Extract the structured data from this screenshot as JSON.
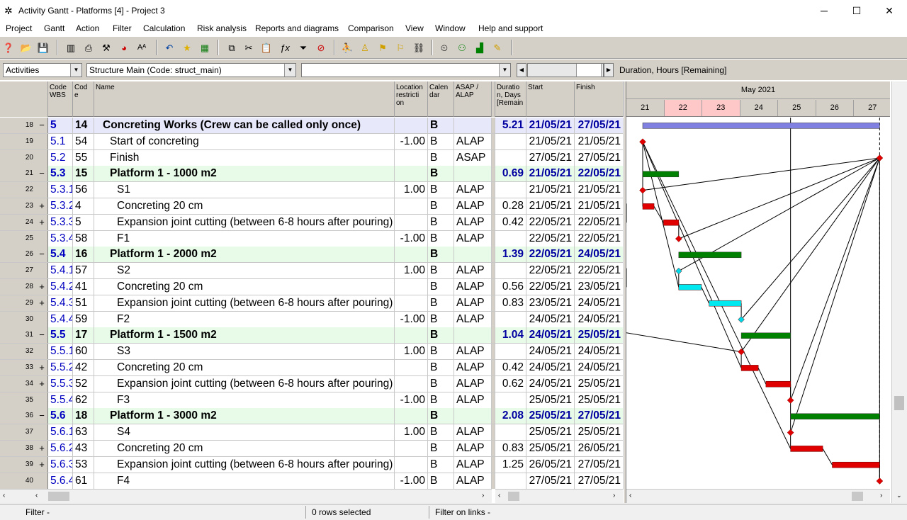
{
  "window": {
    "title": "Activity Gantt - Platforms [4] - Project 3",
    "minimize": "─",
    "maximize": "☐",
    "close": "✕"
  },
  "menu": [
    "Project",
    "Gantt",
    "Action",
    "Filter",
    "Calculation",
    "Risk analysis",
    "Reports and diagrams",
    "Comparison",
    "View",
    "Window",
    "Help and support"
  ],
  "filterbar": {
    "view_select": "Activities",
    "structure_select": "Structure Main (Code: struct_main)",
    "blank_select": "",
    "metric_label": "Duration, Hours [Remaining]"
  },
  "columns": {
    "rownum": "",
    "wbs": "Code\nWBS",
    "code": "Cod\ne",
    "name": "Name",
    "location": "Location\nrestricti\non",
    "calendar": "Calen\ndar",
    "asap": "ASAP /\nALAP",
    "duration": "Duratio\nn, Days\n[Remain",
    "start": "Start",
    "finish": "Finish"
  },
  "gantt_header": {
    "month": "May 2021",
    "days": [
      "21",
      "22",
      "23",
      "24",
      "25",
      "26",
      "27"
    ]
  },
  "rows": [
    {
      "n": "18",
      "ex": "−",
      "wbs": "5",
      "code": "14",
      "name": "Concreting Works (Crew can be called only once)",
      "loc": "",
      "cal": "B",
      "asap": "",
      "dur": "5.21",
      "start": "21/05/21",
      "finish": "27/05/21",
      "type": "top",
      "indent": 0
    },
    {
      "n": "19",
      "ex": "",
      "wbs": "5.1",
      "code": "54",
      "name": "Start of concreting",
      "loc": "-1.00",
      "cal": "B",
      "asap": "ALAP",
      "dur": "",
      "start": "21/05/21",
      "finish": "21/05/21",
      "type": "",
      "indent": 1
    },
    {
      "n": "20",
      "ex": "",
      "wbs": "5.2",
      "code": "55",
      "name": "Finish",
      "loc": "",
      "cal": "B",
      "asap": "ASAP",
      "dur": "",
      "start": "27/05/21",
      "finish": "27/05/21",
      "type": "",
      "indent": 1
    },
    {
      "n": "21",
      "ex": "−",
      "wbs": "5.3",
      "code": "15",
      "name": "Platform 1 - 1000 m2",
      "loc": "",
      "cal": "B",
      "asap": "",
      "dur": "0.69",
      "start": "21/05/21",
      "finish": "22/05/21",
      "type": "sum",
      "indent": 1
    },
    {
      "n": "22",
      "ex": "",
      "wbs": "5.3.1",
      "code": "56",
      "name": "S1",
      "loc": "1.00",
      "cal": "B",
      "asap": "ALAP",
      "dur": "",
      "start": "21/05/21",
      "finish": "21/05/21",
      "type": "",
      "indent": 2
    },
    {
      "n": "23",
      "ex": "+",
      "wbs": "5.3.2",
      "code": "4",
      "name": "Concreting 20 cm",
      "loc": "",
      "cal": "B",
      "asap": "ALAP",
      "dur": "0.28",
      "start": "21/05/21",
      "finish": "21/05/21",
      "type": "",
      "indent": 2
    },
    {
      "n": "24",
      "ex": "+",
      "wbs": "5.3.3",
      "code": "5",
      "name": "Expansion joint cutting (between 6-8 hours after pouring)",
      "loc": "",
      "cal": "B",
      "asap": "ALAP",
      "dur": "0.42",
      "start": "22/05/21",
      "finish": "22/05/21",
      "type": "",
      "indent": 2
    },
    {
      "n": "25",
      "ex": "",
      "wbs": "5.3.4",
      "code": "58",
      "name": "F1",
      "loc": "-1.00",
      "cal": "B",
      "asap": "ALAP",
      "dur": "",
      "start": "22/05/21",
      "finish": "22/05/21",
      "type": "",
      "indent": 2
    },
    {
      "n": "26",
      "ex": "−",
      "wbs": "5.4",
      "code": "16",
      "name": "Platform 1 - 2000 m2",
      "loc": "",
      "cal": "B",
      "asap": "",
      "dur": "1.39",
      "start": "22/05/21",
      "finish": "24/05/21",
      "type": "sum",
      "indent": 1
    },
    {
      "n": "27",
      "ex": "",
      "wbs": "5.4.1",
      "code": "57",
      "name": "S2",
      "loc": "1.00",
      "cal": "B",
      "asap": "ALAP",
      "dur": "",
      "start": "22/05/21",
      "finish": "22/05/21",
      "type": "",
      "indent": 2
    },
    {
      "n": "28",
      "ex": "+",
      "wbs": "5.4.2",
      "code": "41",
      "name": "Concreting 20 cm",
      "loc": "",
      "cal": "B",
      "asap": "ALAP",
      "dur": "0.56",
      "start": "22/05/21",
      "finish": "23/05/21",
      "type": "",
      "indent": 2
    },
    {
      "n": "29",
      "ex": "+",
      "wbs": "5.4.3",
      "code": "51",
      "name": "Expansion joint cutting (between 6-8 hours after pouring)",
      "loc": "",
      "cal": "B",
      "asap": "ALAP",
      "dur": "0.83",
      "start": "23/05/21",
      "finish": "24/05/21",
      "type": "",
      "indent": 2
    },
    {
      "n": "30",
      "ex": "",
      "wbs": "5.4.4",
      "code": "59",
      "name": "F2",
      "loc": "-1.00",
      "cal": "B",
      "asap": "ALAP",
      "dur": "",
      "start": "24/05/21",
      "finish": "24/05/21",
      "type": "",
      "indent": 2
    },
    {
      "n": "31",
      "ex": "−",
      "wbs": "5.5",
      "code": "17",
      "name": "Platform 1 - 1500 m2",
      "loc": "",
      "cal": "B",
      "asap": "",
      "dur": "1.04",
      "start": "24/05/21",
      "finish": "25/05/21",
      "type": "sum",
      "indent": 1
    },
    {
      "n": "32",
      "ex": "",
      "wbs": "5.5.1",
      "code": "60",
      "name": "S3",
      "loc": "1.00",
      "cal": "B",
      "asap": "ALAP",
      "dur": "",
      "start": "24/05/21",
      "finish": "24/05/21",
      "type": "",
      "indent": 2
    },
    {
      "n": "33",
      "ex": "+",
      "wbs": "5.5.2",
      "code": "42",
      "name": "Concreting 20 cm",
      "loc": "",
      "cal": "B",
      "asap": "ALAP",
      "dur": "0.42",
      "start": "24/05/21",
      "finish": "24/05/21",
      "type": "",
      "indent": 2
    },
    {
      "n": "34",
      "ex": "+",
      "wbs": "5.5.3",
      "code": "52",
      "name": "Expansion joint cutting (between 6-8 hours after pouring)",
      "loc": "",
      "cal": "B",
      "asap": "ALAP",
      "dur": "0.62",
      "start": "24/05/21",
      "finish": "25/05/21",
      "type": "",
      "indent": 2
    },
    {
      "n": "35",
      "ex": "",
      "wbs": "5.5.4",
      "code": "62",
      "name": "F3",
      "loc": "-1.00",
      "cal": "B",
      "asap": "ALAP",
      "dur": "",
      "start": "25/05/21",
      "finish": "25/05/21",
      "type": "",
      "indent": 2
    },
    {
      "n": "36",
      "ex": "−",
      "wbs": "5.6",
      "code": "18",
      "name": "Platform 1 - 3000 m2",
      "loc": "",
      "cal": "B",
      "asap": "",
      "dur": "2.08",
      "start": "25/05/21",
      "finish": "27/05/21",
      "type": "sum",
      "indent": 1
    },
    {
      "n": "37",
      "ex": "",
      "wbs": "5.6.1",
      "code": "63",
      "name": "S4",
      "loc": "1.00",
      "cal": "B",
      "asap": "ALAP",
      "dur": "",
      "start": "25/05/21",
      "finish": "25/05/21",
      "type": "",
      "indent": 2
    },
    {
      "n": "38",
      "ex": "+",
      "wbs": "5.6.2",
      "code": "43",
      "name": "Concreting 20 cm",
      "loc": "",
      "cal": "B",
      "asap": "ALAP",
      "dur": "0.83",
      "start": "25/05/21",
      "finish": "26/05/21",
      "type": "",
      "indent": 2
    },
    {
      "n": "39",
      "ex": "+",
      "wbs": "5.6.3",
      "code": "53",
      "name": "Expansion joint cutting (between 6-8 hours after pouring)",
      "loc": "",
      "cal": "B",
      "asap": "ALAP",
      "dur": "1.25",
      "start": "26/05/21",
      "finish": "27/05/21",
      "type": "",
      "indent": 2
    },
    {
      "n": "40",
      "ex": "",
      "wbs": "5.6.4",
      "code": "61",
      "name": "F4",
      "loc": "-1.00",
      "cal": "B",
      "asap": "ALAP",
      "dur": "",
      "start": "27/05/21",
      "finish": "27/05/21",
      "type": "",
      "indent": 2
    }
  ],
  "gantt_bars": [
    {
      "row": 0,
      "kind": "summary",
      "color": "#8080e0",
      "start": 0.0,
      "end": 6.25
    },
    {
      "row": 1,
      "kind": "milestone",
      "color": "#e00000",
      "at": 0.0
    },
    {
      "row": 2,
      "kind": "milestone",
      "color": "#e00000",
      "at": 6.25
    },
    {
      "row": 3,
      "kind": "summary",
      "color": "#008000",
      "start": 0.0,
      "end": 0.95
    },
    {
      "row": 4,
      "kind": "milestone",
      "color": "#e00000",
      "at": 0.0
    },
    {
      "row": 5,
      "kind": "task",
      "color": "#e00000",
      "start": 0.0,
      "end": 0.3
    },
    {
      "row": 6,
      "kind": "task",
      "color": "#e00000",
      "start": 0.55,
      "end": 0.95
    },
    {
      "row": 7,
      "kind": "milestone",
      "color": "#e00000",
      "at": 0.95
    },
    {
      "row": 8,
      "kind": "summary",
      "color": "#008000",
      "start": 0.95,
      "end": 2.6
    },
    {
      "row": 9,
      "kind": "milestone",
      "color": "#00d8e8",
      "at": 0.95
    },
    {
      "row": 10,
      "kind": "task",
      "color": "#00e8f0",
      "start": 0.95,
      "end": 1.55
    },
    {
      "row": 11,
      "kind": "task",
      "color": "#00e8f0",
      "start": 1.75,
      "end": 2.6
    },
    {
      "row": 12,
      "kind": "milestone",
      "color": "#00d8e8",
      "at": 2.6
    },
    {
      "row": 13,
      "kind": "summary",
      "color": "#008000",
      "start": 2.6,
      "end": 3.9
    },
    {
      "row": 14,
      "kind": "milestone",
      "color": "#e00000",
      "at": 2.6
    },
    {
      "row": 15,
      "kind": "task",
      "color": "#e00000",
      "start": 2.6,
      "end": 3.05
    },
    {
      "row": 16,
      "kind": "task",
      "color": "#e00000",
      "start": 3.25,
      "end": 3.9
    },
    {
      "row": 17,
      "kind": "milestone",
      "color": "#e00000",
      "at": 3.9
    },
    {
      "row": 18,
      "kind": "summary",
      "color": "#008000",
      "start": 3.9,
      "end": 6.25
    },
    {
      "row": 19,
      "kind": "milestone",
      "color": "#e00000",
      "at": 3.9
    },
    {
      "row": 20,
      "kind": "task",
      "color": "#e00000",
      "start": 3.9,
      "end": 4.75
    },
    {
      "row": 21,
      "kind": "task",
      "color": "#e00000",
      "start": 5.0,
      "end": 6.25
    },
    {
      "row": 22,
      "kind": "milestone",
      "color": "#e00000",
      "at": 6.25
    }
  ],
  "status": {
    "filter": "Filter -",
    "selected": "0 rows selected",
    "link_filter": "Filter on links -"
  },
  "colors": {
    "top_row": "#e8e8fb",
    "summary_row": "#e8fbe8",
    "weekend": "#ffc8c8",
    "wbs_text": "#0000c0"
  }
}
